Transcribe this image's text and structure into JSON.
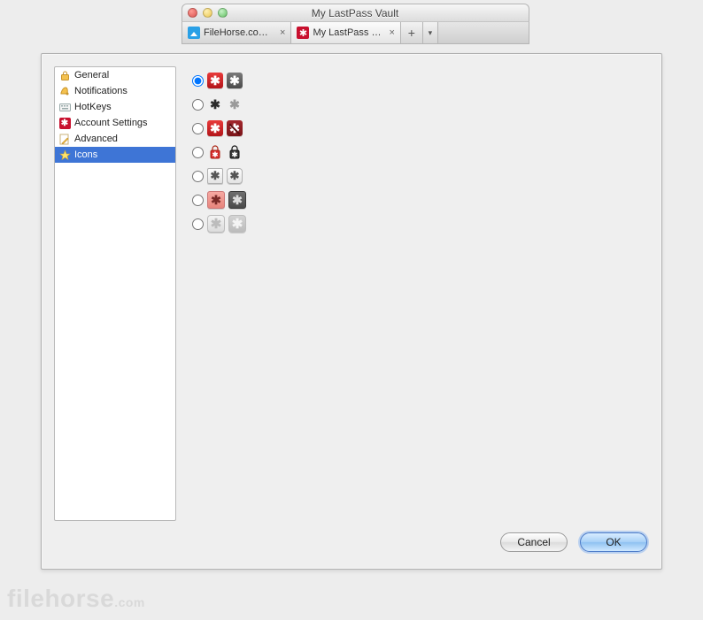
{
  "window": {
    "title": "My LastPass Vault"
  },
  "tabs": [
    {
      "label": "FileHorse.com...",
      "icon": "fh",
      "active": false
    },
    {
      "label": "My LastPass V...",
      "icon": "lp",
      "active": true
    }
  ],
  "sidebar": {
    "items": [
      {
        "label": "General",
        "icon": "lock"
      },
      {
        "label": "Notifications",
        "icon": "bell"
      },
      {
        "label": "HotKeys",
        "icon": "key"
      },
      {
        "label": "Account Settings",
        "icon": "lp"
      },
      {
        "label": "Advanced",
        "icon": "pencil"
      },
      {
        "label": "Icons",
        "icon": "star"
      }
    ],
    "selected_index": 5
  },
  "icon_options": [
    {
      "id": "classic",
      "selected": true
    },
    {
      "id": "plain-asterisk",
      "selected": false
    },
    {
      "id": "red-slash",
      "selected": false
    },
    {
      "id": "padlock",
      "selected": false
    },
    {
      "id": "button-asterisk",
      "selected": false
    },
    {
      "id": "pink-gray",
      "selected": false
    },
    {
      "id": "disabled-gray",
      "selected": false
    }
  ],
  "buttons": {
    "cancel": "Cancel",
    "ok": "OK"
  },
  "watermark": {
    "main": "filehorse",
    "suffix": ".com"
  }
}
